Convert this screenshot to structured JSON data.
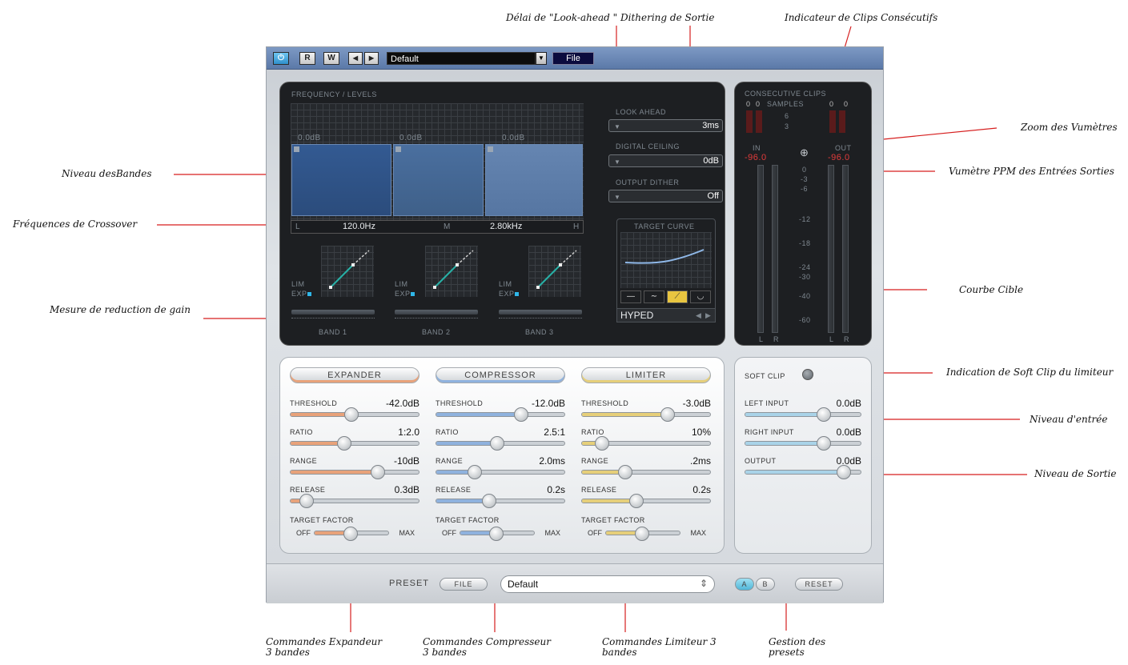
{
  "annotations": {
    "lookahead": "Délai de \"Look-ahead \" Dithering de Sortie",
    "consec": "Indicateur de Clips Consécutifs",
    "zoom": "Zoom des Vumètres",
    "vumeter": "Vumètre PPM des Entrées Sorties",
    "band_level": "Niveau desBandes",
    "crossover": "Fréquences de Crossover",
    "target_curve": "Courbe Cible",
    "gain_reduction": "Mesure de reduction de gain",
    "softclip": "Indication de Soft Clip du limiteur",
    "input_level": "Niveau d'entrée",
    "output_level": "Niveau de Sortie",
    "expander_ctrl": "Commandes Expandeur 3 bandes",
    "compressor_ctrl": "Commandes Compresseur 3 bandes",
    "limiter_ctrl": "Commandes Limiteur 3 bandes",
    "preset_mgmt": "Gestion des presets"
  },
  "topbar": {
    "power": "⏻",
    "r": "R",
    "w": "W",
    "prev": "◀",
    "next": "▶",
    "preset": "Default",
    "dropdown": "▼",
    "file": "File"
  },
  "freq_panel": {
    "title": "FREQUENCY / LEVELS",
    "band_db": [
      "0.0dB",
      "0.0dB",
      "0.0dB"
    ],
    "low_tag": "L",
    "mid_tag": "M",
    "high_tag": "H",
    "crossover_low": "120.0Hz",
    "crossover_high": "2.80kHz",
    "lim": "LIM",
    "exp": "EXP",
    "band_names": [
      "BAND 1",
      "BAND 2",
      "BAND 3"
    ]
  },
  "settings": {
    "lookahead_label": "LOOK AHEAD",
    "lookahead_value": "3ms",
    "ceiling_label": "DIGITAL CEILING",
    "ceiling_value": "0dB",
    "dither_label": "OUTPUT DITHER",
    "dither_value": "Off",
    "curve_label": "TARGET CURVE",
    "curve_name": "HYPED"
  },
  "meters": {
    "title": "CONSECUTIVE CLIPS",
    "samples": "SAMPLES",
    "clip_left": [
      "0",
      "0"
    ],
    "clip_right": [
      "0",
      "0"
    ],
    "clip_scale": [
      "6",
      "3"
    ],
    "in_label": "IN",
    "out_label": "OUT",
    "in_peak": "-96.0",
    "out_peak": "-96.0",
    "scale": [
      "0",
      "-3",
      "-6",
      "-12",
      "-18",
      "-24",
      "-30",
      "-40",
      "-60"
    ],
    "l": "L",
    "r": "R"
  },
  "modules": [
    {
      "name": "EXPANDER",
      "accent": "#e8a27a",
      "params": [
        {
          "label": "THRESHOLD",
          "value": "-42.0dB",
          "level": 0.47
        },
        {
          "label": "RATIO",
          "value": "1:2.0",
          "level": 0.41
        },
        {
          "label": "RANGE",
          "value": "-10dB",
          "level": 0.7
        },
        {
          "label": "RELEASE",
          "value": "0.3dB",
          "level": 0.08
        }
      ],
      "target_factor": 0.48
    },
    {
      "name": "COMPRESSOR",
      "accent": "#8fb2de",
      "params": [
        {
          "label": "THRESHOLD",
          "value": "-12.0dB",
          "level": 0.68
        },
        {
          "label": "RATIO",
          "value": "2.5:1",
          "level": 0.47
        },
        {
          "label": "RANGE",
          "value": "2.0ms",
          "level": 0.28
        },
        {
          "label": "RELEASE",
          "value": "0.2s",
          "level": 0.4
        }
      ],
      "target_factor": 0.48
    },
    {
      "name": "LIMITER",
      "accent": "#e6cf7a",
      "params": [
        {
          "label": "THRESHOLD",
          "value": "-3.0dB",
          "level": 0.69
        },
        {
          "label": "RATIO",
          "value": "10%",
          "level": 0.12
        },
        {
          "label": "RANGE",
          "value": ".2ms",
          "level": 0.32
        },
        {
          "label": "RELEASE",
          "value": "0.2s",
          "level": 0.42
        }
      ],
      "target_factor": 0.48
    }
  ],
  "target_factor": {
    "label": "TARGET FACTOR",
    "off": "OFF",
    "max": "MAX"
  },
  "io": {
    "softclip": "SOFT CLIP",
    "left_input_label": "LEFT INPUT",
    "left_input_value": "0.0dB",
    "left_input_level": 0.7,
    "right_input_label": "RIGHT INPUT",
    "right_input_value": "0.0dB",
    "right_input_level": 0.7,
    "output_label": "OUTPUT",
    "output_value": "0.0dB",
    "output_level": 0.9
  },
  "bottom": {
    "preset_label": "PRESET",
    "file": "FILE",
    "preset_value": "Default",
    "spinner": "⇕",
    "a": "A",
    "b": "B",
    "reset": "RESET"
  }
}
